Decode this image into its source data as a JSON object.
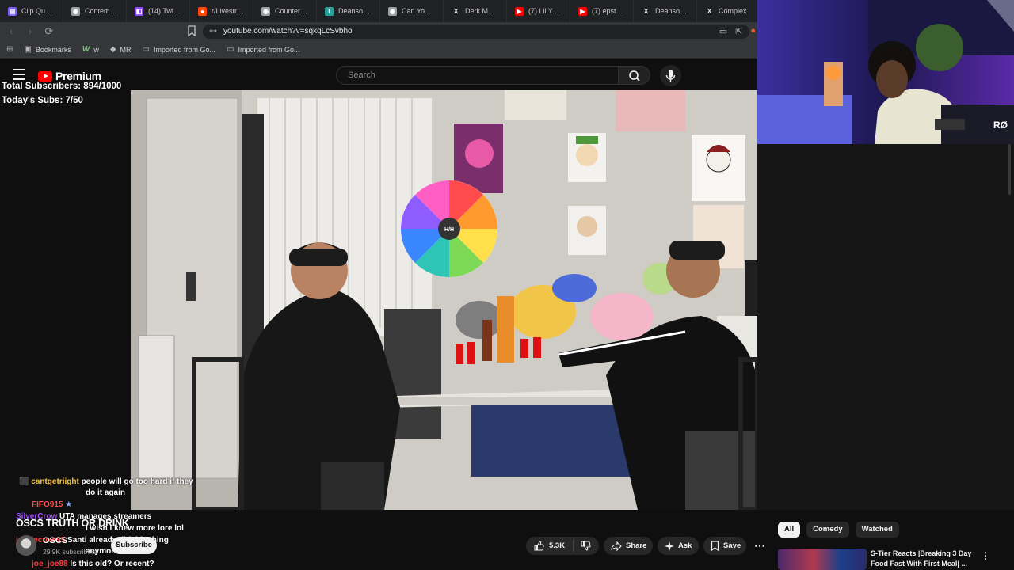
{
  "browser": {
    "tabs": [
      {
        "label": "Clip Queue",
        "icon": "clip-queue-icon",
        "color": "#7b5cff"
      },
      {
        "label": "Contempora",
        "icon": "web-icon",
        "color": "#9aa0a6"
      },
      {
        "label": "(14) Twitch",
        "icon": "twitch-icon",
        "color": "#9146ff"
      },
      {
        "label": "r/Livestream",
        "icon": "reddit-icon",
        "color": "#ff4500"
      },
      {
        "label": "Counter-Strik",
        "icon": "web-icon",
        "color": "#9aa0a6"
      },
      {
        "label": "Deansocool",
        "icon": "t-icon",
        "color": "#2aa198"
      },
      {
        "label": "Can You Nam",
        "icon": "web-icon",
        "color": "#9aa0a6"
      },
      {
        "label": "Derk Matison",
        "icon": "x-icon",
        "color": "#e8eaed"
      },
      {
        "label": "(7) Lil Yachty",
        "icon": "youtube-icon",
        "color": "#ff0000"
      },
      {
        "label": "(7) epstein",
        "icon": "youtube-icon",
        "color": "#ff0000"
      },
      {
        "label": "Deansocool",
        "icon": "x-icon",
        "color": "#e8eaed"
      },
      {
        "label": "Complex",
        "icon": "x-icon",
        "color": "#e8eaed"
      }
    ],
    "url": "youtube.com/watch?v=sqkqLcSvbho",
    "bookmarks": [
      {
        "label": "Bookmarks",
        "icon": "bookmarks-icon"
      },
      {
        "label": "w",
        "icon": "w-icon"
      },
      {
        "label": "MR",
        "icon": "mr-icon"
      },
      {
        "label": "Imported from Go...",
        "icon": "folder-icon"
      },
      {
        "label": "Imported from Go...",
        "icon": "folder-icon"
      }
    ]
  },
  "youtube": {
    "logo_text": "Premium",
    "search_placeholder": "Search",
    "video_title": "OSCS TRUTH OR DRINK",
    "channel": {
      "name": "OSCS",
      "subs": "29.9K subscribers"
    },
    "subscribe_label": "Subscribe",
    "likes": "5.3K",
    "share_label": "Share",
    "ask_label": "Ask",
    "save_label": "Save",
    "chips": [
      "All",
      "Comedy",
      "Watched"
    ],
    "recommendation": {
      "title": "S-Tier Reacts |Breaking 3 Day Food Fast With First Meal| ..."
    }
  },
  "overlay": {
    "total_subs": "Total Subscribers: 894/1000",
    "todays_subs": "Today's Subs: 7/50",
    "chat": [
      {
        "name": "cantgetriight",
        "color": "#f5c542",
        "message": "people will go too hard if they"
      },
      {
        "name": "",
        "color": "#ffffff",
        "message": "do it again"
      },
      {
        "name": "FIFO915",
        "color": "#ff4d4d",
        "message": ""
      },
      {
        "name": "SilverCrow",
        "color": "#a04cff",
        "message": "UTA manages streamers"
      },
      {
        "name": "",
        "color": "#4d7dff",
        "message": "I wish I knew more lore lol"
      },
      {
        "name": "jessiecrow95",
        "color": "#ff3b3b",
        "message": "Santi already did this thing"
      },
      {
        "name": "",
        "color": "#ffffff",
        "message": "anymore"
      },
      {
        "name": "joe_joe88",
        "color": "#ff3b3b",
        "message": "Is this old? Or recent?"
      }
    ]
  },
  "webcam": {
    "overlay_text": "RØ"
  },
  "video_scene": {
    "wheel_label": "H/H"
  }
}
